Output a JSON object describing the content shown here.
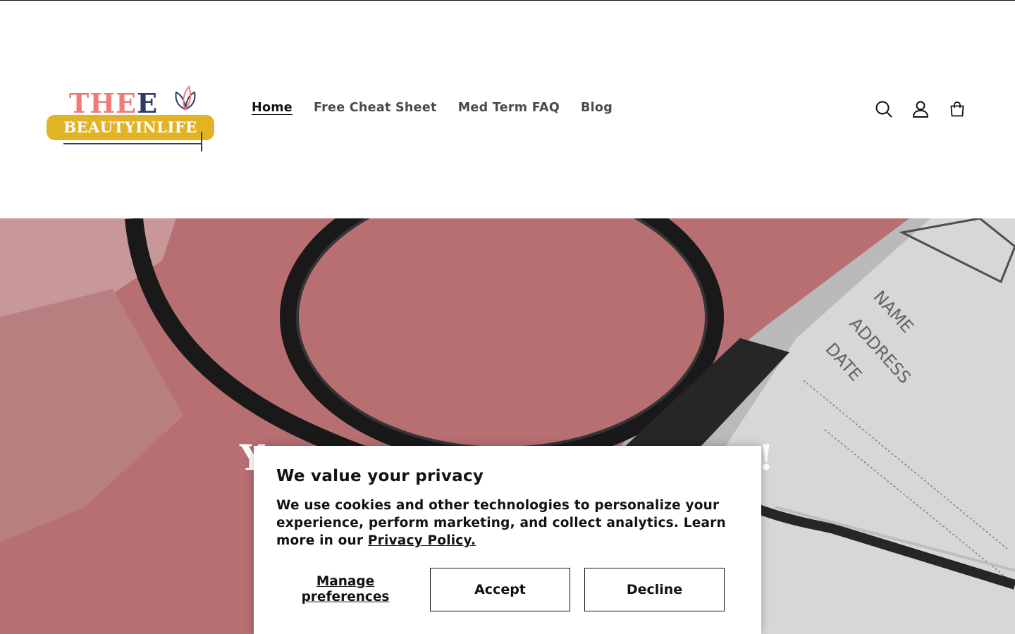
{
  "logo": {
    "line1_a": "THE",
    "line1_b": "E",
    "line2": "BEAUTYINLIFE",
    "icon": "lotus-icon"
  },
  "nav": {
    "items": [
      "Home",
      "Free Cheat Sheet",
      "Med Term FAQ",
      "Blog"
    ],
    "active": "Home"
  },
  "header_icons": [
    "search-icon",
    "account-icon",
    "cart-icon"
  ],
  "hero": {
    "title_left": "Y",
    "title_right": "!",
    "image_labels": [
      "NAME",
      "ADDRESS",
      "DATE"
    ]
  },
  "cookie": {
    "title": "We value your privacy",
    "body": "We use cookies and other technologies to personalize your experience, perform marketing, and collect analytics. Learn more in our ",
    "link": "Privacy Policy.",
    "manage": "Manage preferences",
    "accept": "Accept",
    "decline": "Decline"
  },
  "colors": {
    "logo_pink": "#f07a78",
    "logo_navy": "#2d3a63",
    "logo_gold": "#e2b325",
    "text": "#121212"
  }
}
